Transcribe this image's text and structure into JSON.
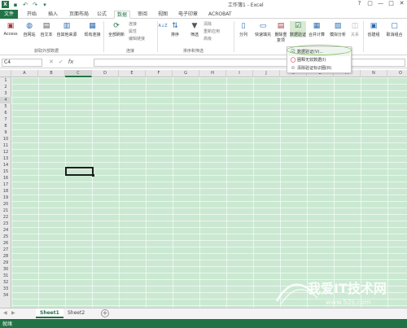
{
  "window": {
    "title": "工作簿1 - Excel",
    "controls": [
      "?",
      "▢",
      "—",
      "□",
      "✕"
    ]
  },
  "tabs": [
    {
      "label": "文件",
      "type": "file"
    },
    {
      "label": "开始"
    },
    {
      "label": "插入"
    },
    {
      "label": "页面布局"
    },
    {
      "label": "公式"
    },
    {
      "label": "数据",
      "active": true
    },
    {
      "label": "审阅"
    },
    {
      "label": "视图"
    },
    {
      "label": "电子印章"
    },
    {
      "label": "ACROBAT"
    }
  ],
  "ribbon": {
    "get_external": {
      "label": "获取外部数据",
      "buttons": [
        "Access",
        "自网站",
        "自文本",
        "自其他来源",
        "现有连接"
      ]
    },
    "connections": {
      "label": "连接",
      "refresh_all": "全部刷新",
      "small": [
        "连接",
        "属性",
        "编辑链接"
      ]
    },
    "sort_filter": {
      "label": "排序和筛选",
      "sort_az": "A↓Z",
      "sort": "排序",
      "filter": "筛选",
      "small": [
        "清除",
        "重新应用",
        "高级"
      ]
    },
    "data_tools": {
      "buttons": [
        "分列",
        "快速填充",
        "删除重复项",
        "数据验证",
        "合并计算",
        "模拟分析",
        "关系"
      ]
    },
    "outline": {
      "buttons": [
        "创建组",
        "取消组合"
      ]
    }
  },
  "dropdown": {
    "items": [
      {
        "label": "数据验证(V)...",
        "icon": "data-validation-icon"
      },
      {
        "label": "圈释无效数据(I)",
        "icon": "circle-invalid-icon"
      },
      {
        "label": "清除验证标识圈(R)",
        "icon": "clear-circles-icon"
      }
    ]
  },
  "formula_bar": {
    "name_box": "C4",
    "fx": "fx",
    "value": ""
  },
  "grid": {
    "columns": [
      "A",
      "B",
      "C",
      "D",
      "E",
      "F",
      "G",
      "H",
      "I",
      "J",
      "K",
      "L",
      "M",
      "N",
      "O"
    ],
    "rows": [
      "1",
      "2",
      "3",
      "4",
      "5",
      "6",
      "7",
      "8",
      "9",
      "10",
      "11",
      "12",
      "13",
      "14",
      "15",
      "16",
      "17",
      "18",
      "19",
      "20",
      "21",
      "22",
      "23",
      "24",
      "25",
      "26",
      "27",
      "28",
      "29",
      "30",
      "31",
      "32",
      "33",
      "34"
    ],
    "selected_column": "C",
    "selected_row": "4"
  },
  "sheets": {
    "tabs": [
      {
        "label": "Sheet1",
        "active": true
      },
      {
        "label": "Sheet2"
      }
    ],
    "add": "+"
  },
  "status": {
    "text": "就绪"
  },
  "watermark": {
    "text": "我爱IT技术网",
    "url": "www.52ij.com"
  },
  "colors": {
    "accent": "#217346",
    "grid_bg": "#cbe9d2"
  }
}
